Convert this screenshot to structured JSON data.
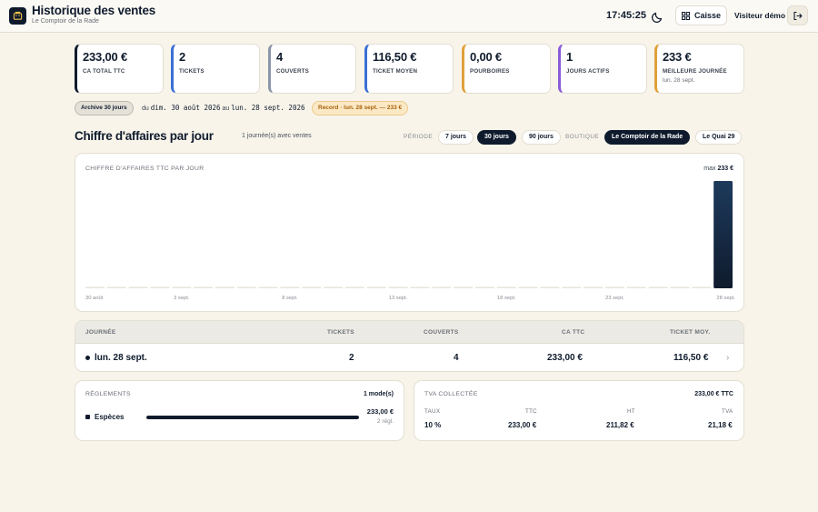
{
  "app": {
    "title": "Historique des ventes",
    "subtitle": "Le Comptoir de la Rade",
    "clock": "17:45:25",
    "caisse_label": "Caisse",
    "user_label": "Visiteur démo"
  },
  "stats": [
    {
      "value": "233,00 €",
      "label": "CA TOTAL TTC",
      "note": "",
      "color": "#0f1b2d"
    },
    {
      "value": "2",
      "label": "TICKETS",
      "note": "",
      "color": "#3b6fd6"
    },
    {
      "value": "4",
      "label": "COUVERTS",
      "note": "",
      "color": "#8a96a8"
    },
    {
      "value": "116,50 €",
      "label": "TICKET MOYEN",
      "note": "",
      "color": "#3b6fd6"
    },
    {
      "value": "0,00 €",
      "label": "POURBOIRES",
      "note": "",
      "color": "#e0a03a"
    },
    {
      "value": "1",
      "label": "JOURS ACTIFS",
      "note": "",
      "color": "#8a5cd8"
    },
    {
      "value": "233 €",
      "label": "MEILLEURE JOURNÉE",
      "note": "lun. 28 sept.",
      "color": "#e0a03a"
    }
  ],
  "range": {
    "archive_label": "Archive 30 jours",
    "from_word": "du",
    "from": "dim. 30 août 2026",
    "to_word": "au",
    "to": "lun. 28 sept. 2026",
    "record": "Record · lun. 28 sept. — 233 €"
  },
  "section": {
    "title": "Chiffre d'affaires par jour",
    "subtitle": "1 journée(s) avec ventes"
  },
  "filters": {
    "periode_label": "PÉRIODE",
    "periods": [
      "7 jours",
      "30 jours",
      "90 jours"
    ],
    "periode_active": 1,
    "boutique_label": "BOUTIQUE",
    "shops": [
      "Le Comptoir de la Rade",
      "Le Quai 29"
    ],
    "shop_active": 0
  },
  "chart": {
    "title": "CHIFFRE D'AFFAIRES TTC PAR JOUR",
    "max_prefix": "max",
    "max_value": "233 €"
  },
  "chart_data": {
    "type": "bar",
    "categories": [
      "30 août",
      "31 août",
      "1 sept.",
      "2 sept.",
      "3 sept.",
      "4 sept.",
      "5 sept.",
      "6 sept.",
      "7 sept.",
      "8 sept.",
      "9 sept.",
      "10 sept.",
      "11 sept.",
      "12 sept.",
      "13 sept.",
      "14 sept.",
      "15 sept.",
      "16 sept.",
      "17 sept.",
      "18 sept.",
      "19 sept.",
      "20 sept.",
      "21 sept.",
      "22 sept.",
      "23 sept.",
      "24 sept.",
      "25 sept.",
      "26 sept.",
      "27 sept.",
      "28 sept."
    ],
    "values": [
      0,
      0,
      0,
      0,
      0,
      0,
      0,
      0,
      0,
      0,
      0,
      0,
      0,
      0,
      0,
      0,
      0,
      0,
      0,
      0,
      0,
      0,
      0,
      0,
      0,
      0,
      0,
      0,
      0,
      233
    ],
    "tick_labels": [
      "30 août",
      "3 sept.",
      "8 sept.",
      "13 sept.",
      "18 sept.",
      "23 sept.",
      "28 sept."
    ],
    "tick_indices": [
      0,
      4,
      9,
      14,
      19,
      24,
      29
    ],
    "title": "CHIFFRE D'AFFAIRES TTC PAR JOUR",
    "ylim": [
      0,
      233
    ]
  },
  "table": {
    "headers": [
      "JOURNÉE",
      "TICKETS",
      "COUVERTS",
      "CA TTC",
      "TICKET MOY."
    ],
    "rows": [
      {
        "day": "lun. 28 sept.",
        "tickets": "2",
        "couverts": "4",
        "ca": "233,00 €",
        "moy": "116,50 €"
      }
    ]
  },
  "payments": {
    "title": "RÈGLEMENTS",
    "count_label": "1 mode(s)",
    "items": [
      {
        "name": "Espèces",
        "amount": "233,00 €",
        "count": "2 régl.",
        "share": 1.0
      }
    ]
  },
  "tva": {
    "title": "TVA COLLECTÉE",
    "total": "233,00 € TTC",
    "headers": [
      "TAUX",
      "TTC",
      "HT",
      "TVA"
    ],
    "rows": [
      {
        "taux": "10 %",
        "ttc": "233,00 €",
        "ht": "211,82 €",
        "tva": "21,18 €"
      }
    ]
  }
}
